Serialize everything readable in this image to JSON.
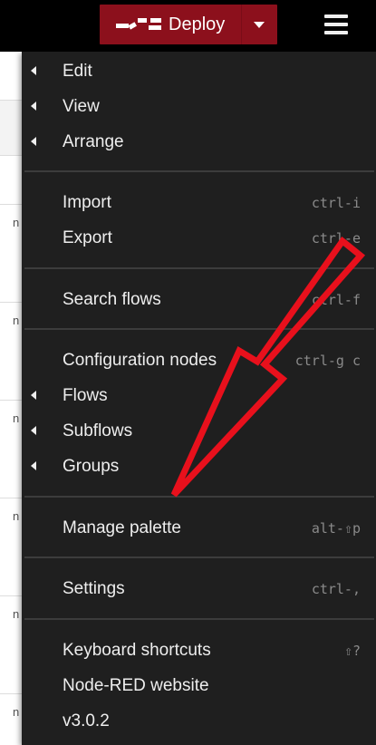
{
  "header": {
    "deploy_label": "Deploy",
    "deploy_color": "#8c101c",
    "menu_icon": "hamburger-menu-icon"
  },
  "background": {
    "row_letter": "n"
  },
  "menu": {
    "edit": "Edit",
    "view": "View",
    "arrange": "Arrange",
    "import": "Import",
    "import_key": "ctrl-i",
    "export": "Export",
    "export_key": "ctrl-e",
    "search_flows": "Search flows",
    "search_key": "ctrl-f",
    "config_nodes": "Configuration nodes",
    "config_key": "ctrl-g c",
    "flows": "Flows",
    "subflows": "Subflows",
    "groups": "Groups",
    "manage_palette": "Manage palette",
    "palette_key": "alt-⇧p",
    "settings": "Settings",
    "settings_key": "ctrl-,",
    "keyboard_shortcuts": "Keyboard shortcuts",
    "shortcuts_key": "⇧?",
    "website": "Node-RED website",
    "version": "v3.0.2"
  },
  "annotation": {
    "arrow_color": "#e8101c"
  }
}
